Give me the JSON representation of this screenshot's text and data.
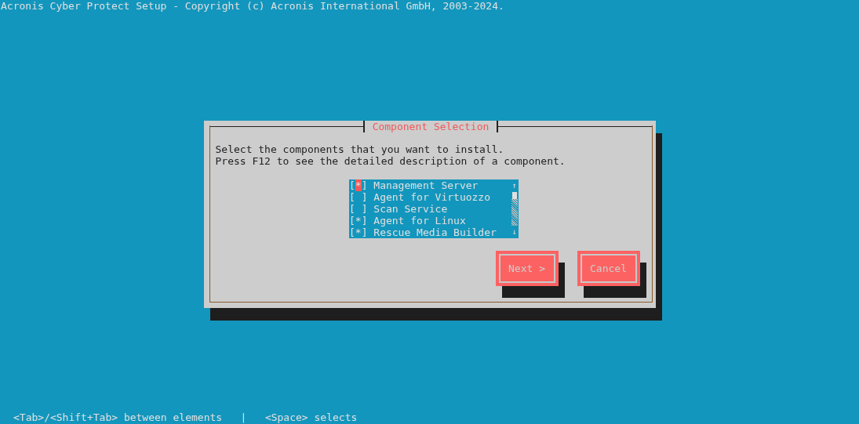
{
  "title": "Acronis Cyber Protect Setup - Copyright (c) Acronis International GmbH, 2003-2024.",
  "dialog": {
    "title": "Component Selection",
    "prompt": [
      "Select the components that you want to install.",
      "Press F12 to see the detailed description of a component."
    ],
    "components": [
      {
        "label": "Management Server",
        "checked": true,
        "cursor": true
      },
      {
        "label": "Agent for Virtuozzo",
        "checked": false,
        "cursor": false
      },
      {
        "label": "Scan Service",
        "checked": false,
        "cursor": false
      },
      {
        "label": "Agent for Linux",
        "checked": true,
        "cursor": false
      },
      {
        "label": "Rescue Media Builder",
        "checked": true,
        "cursor": false
      }
    ],
    "box_open": "[",
    "box_close": "]",
    "check_mark": "*",
    "scroll_up": "↑",
    "scroll_down": "↓",
    "buttons": [
      "Next >",
      "Cancel"
    ]
  },
  "status_bar": "<Tab>/<Shift+Tab> between elements   |   <Space> selects"
}
